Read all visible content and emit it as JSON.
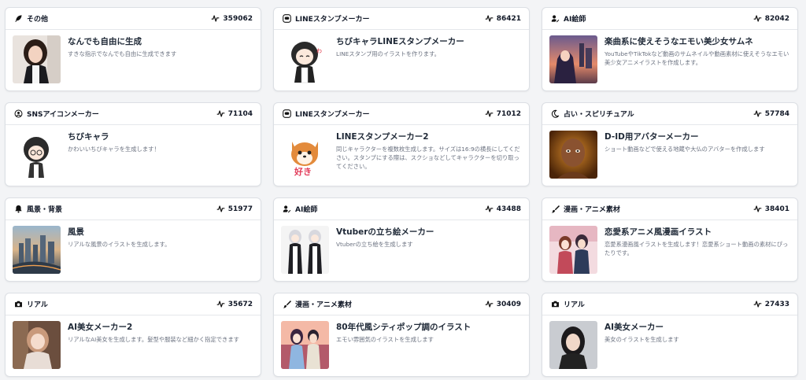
{
  "cards": [
    {
      "category": "その他",
      "category_icon": "feather-icon",
      "count": "359062",
      "title": "なんでも自由に生成",
      "desc": "すきな指示でなんでも自由に生成できます",
      "thumb": "idol-portrait-thumbnail"
    },
    {
      "category": "LINEスタンプメーカー",
      "category_icon": "line-chat-icon",
      "count": "86421",
      "title": "ちびキャラLINEスタンプメーカー",
      "desc": "LINEスタンプ用のイラストを作ります。",
      "thumb": "chibi-maid-thumbnail"
    },
    {
      "category": "AI絵師",
      "category_icon": "user-pen-icon",
      "count": "82042",
      "title": "楽曲系に使えそうなエモい美少女サムネ",
      "desc": "YouTubeやTikTokなど動画のサムネイルや動画素材に使えそうなエモい美少女アニメイラストを作成します。",
      "thumb": "anime-girl-city-thumbnail"
    },
    {
      "category": "SNSアイコンメーカー",
      "category_icon": "user-circle-icon",
      "count": "71104",
      "title": "ちびキャラ",
      "desc": "かわいいちびキャラを生成します！",
      "thumb": "chibi-glasses-thumbnail"
    },
    {
      "category": "LINEスタンプメーカー",
      "category_icon": "line-chat-icon",
      "count": "71012",
      "title": "LINEスタンプメーカー2",
      "desc": "同じキャラクターを複数枚生成します。サイズは16:9の横長にしてください。スタンプにする際は、スクショなどしてキャラクターを切り取ってください。",
      "thumb": "shiba-dog-thumbnail"
    },
    {
      "category": "占い・スピリチュアル",
      "category_icon": "moon-icon",
      "count": "57784",
      "title": "D-ID用アバターメーカー",
      "desc": "ショート動画などで使える地蔵や大仏のアバターを作成します",
      "thumb": "monk-avatar-thumbnail"
    },
    {
      "category": "風景・背景",
      "category_icon": "bell-icon",
      "count": "51977",
      "title": "風景",
      "desc": "リアルな風景のイラストを生成します。",
      "thumb": "cityscape-thumbnail"
    },
    {
      "category": "AI絵師",
      "category_icon": "user-pen-icon",
      "count": "43488",
      "title": "Vtuberの立ち絵メーカー",
      "desc": "Vtuberの立ち絵を生成します",
      "thumb": "vtuber-maid-thumbnail"
    },
    {
      "category": "漫画・アニメ素材",
      "category_icon": "brush-icon",
      "count": "38401",
      "title": "恋愛系アニメ風漫画イラスト",
      "desc": "恋愛系漫画風イラストを生成します！恋愛系ショート動画の素材にぴったりです。",
      "thumb": "romance-couple-thumbnail"
    },
    {
      "category": "リアル",
      "category_icon": "camera-icon",
      "count": "35672",
      "title": "AI美女メーカー2",
      "desc": "リアルなAI美女を生成します。髪型や服装など細かく指定できます",
      "thumb": "cafe-woman-thumbnail"
    },
    {
      "category": "漫画・アニメ素材",
      "category_icon": "brush-icon",
      "count": "30409",
      "title": "80年代風シティポップ調のイラスト",
      "desc": "エモい雰囲気のイラストを生成します",
      "thumb": "citypop-couple-thumbnail"
    },
    {
      "category": "リアル",
      "category_icon": "camera-icon",
      "count": "27433",
      "title": "AI美女メーカー",
      "desc": "美女のイラストを生成します",
      "thumb": "dark-hair-woman-thumbnail"
    }
  ]
}
